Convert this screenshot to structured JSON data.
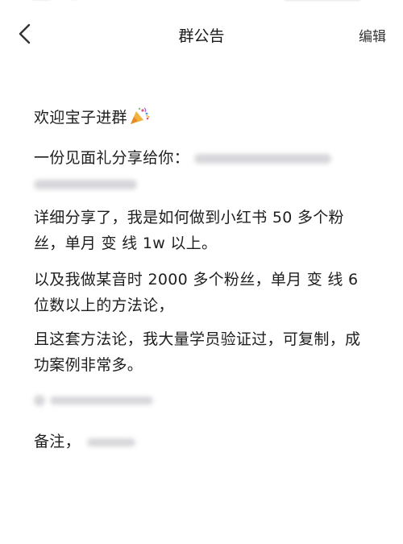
{
  "header": {
    "title": "群公告",
    "edit_label": "编辑"
  },
  "announcement": {
    "welcome": "欢迎宝子进群",
    "gift_line": "一份见面礼分享给你：",
    "detail_1": "详细分享了，我是如何做到小红书 50 多个粉丝，单月 变 线 1w 以上。",
    "detail_2": "以及我做某音时 2000 多个粉丝，单月 变 线  6 位数以上的方法论，",
    "detail_3": "且这套方法论，我大量学员验证过，可复制，成功案例非常多。",
    "note_label": "备注，"
  }
}
